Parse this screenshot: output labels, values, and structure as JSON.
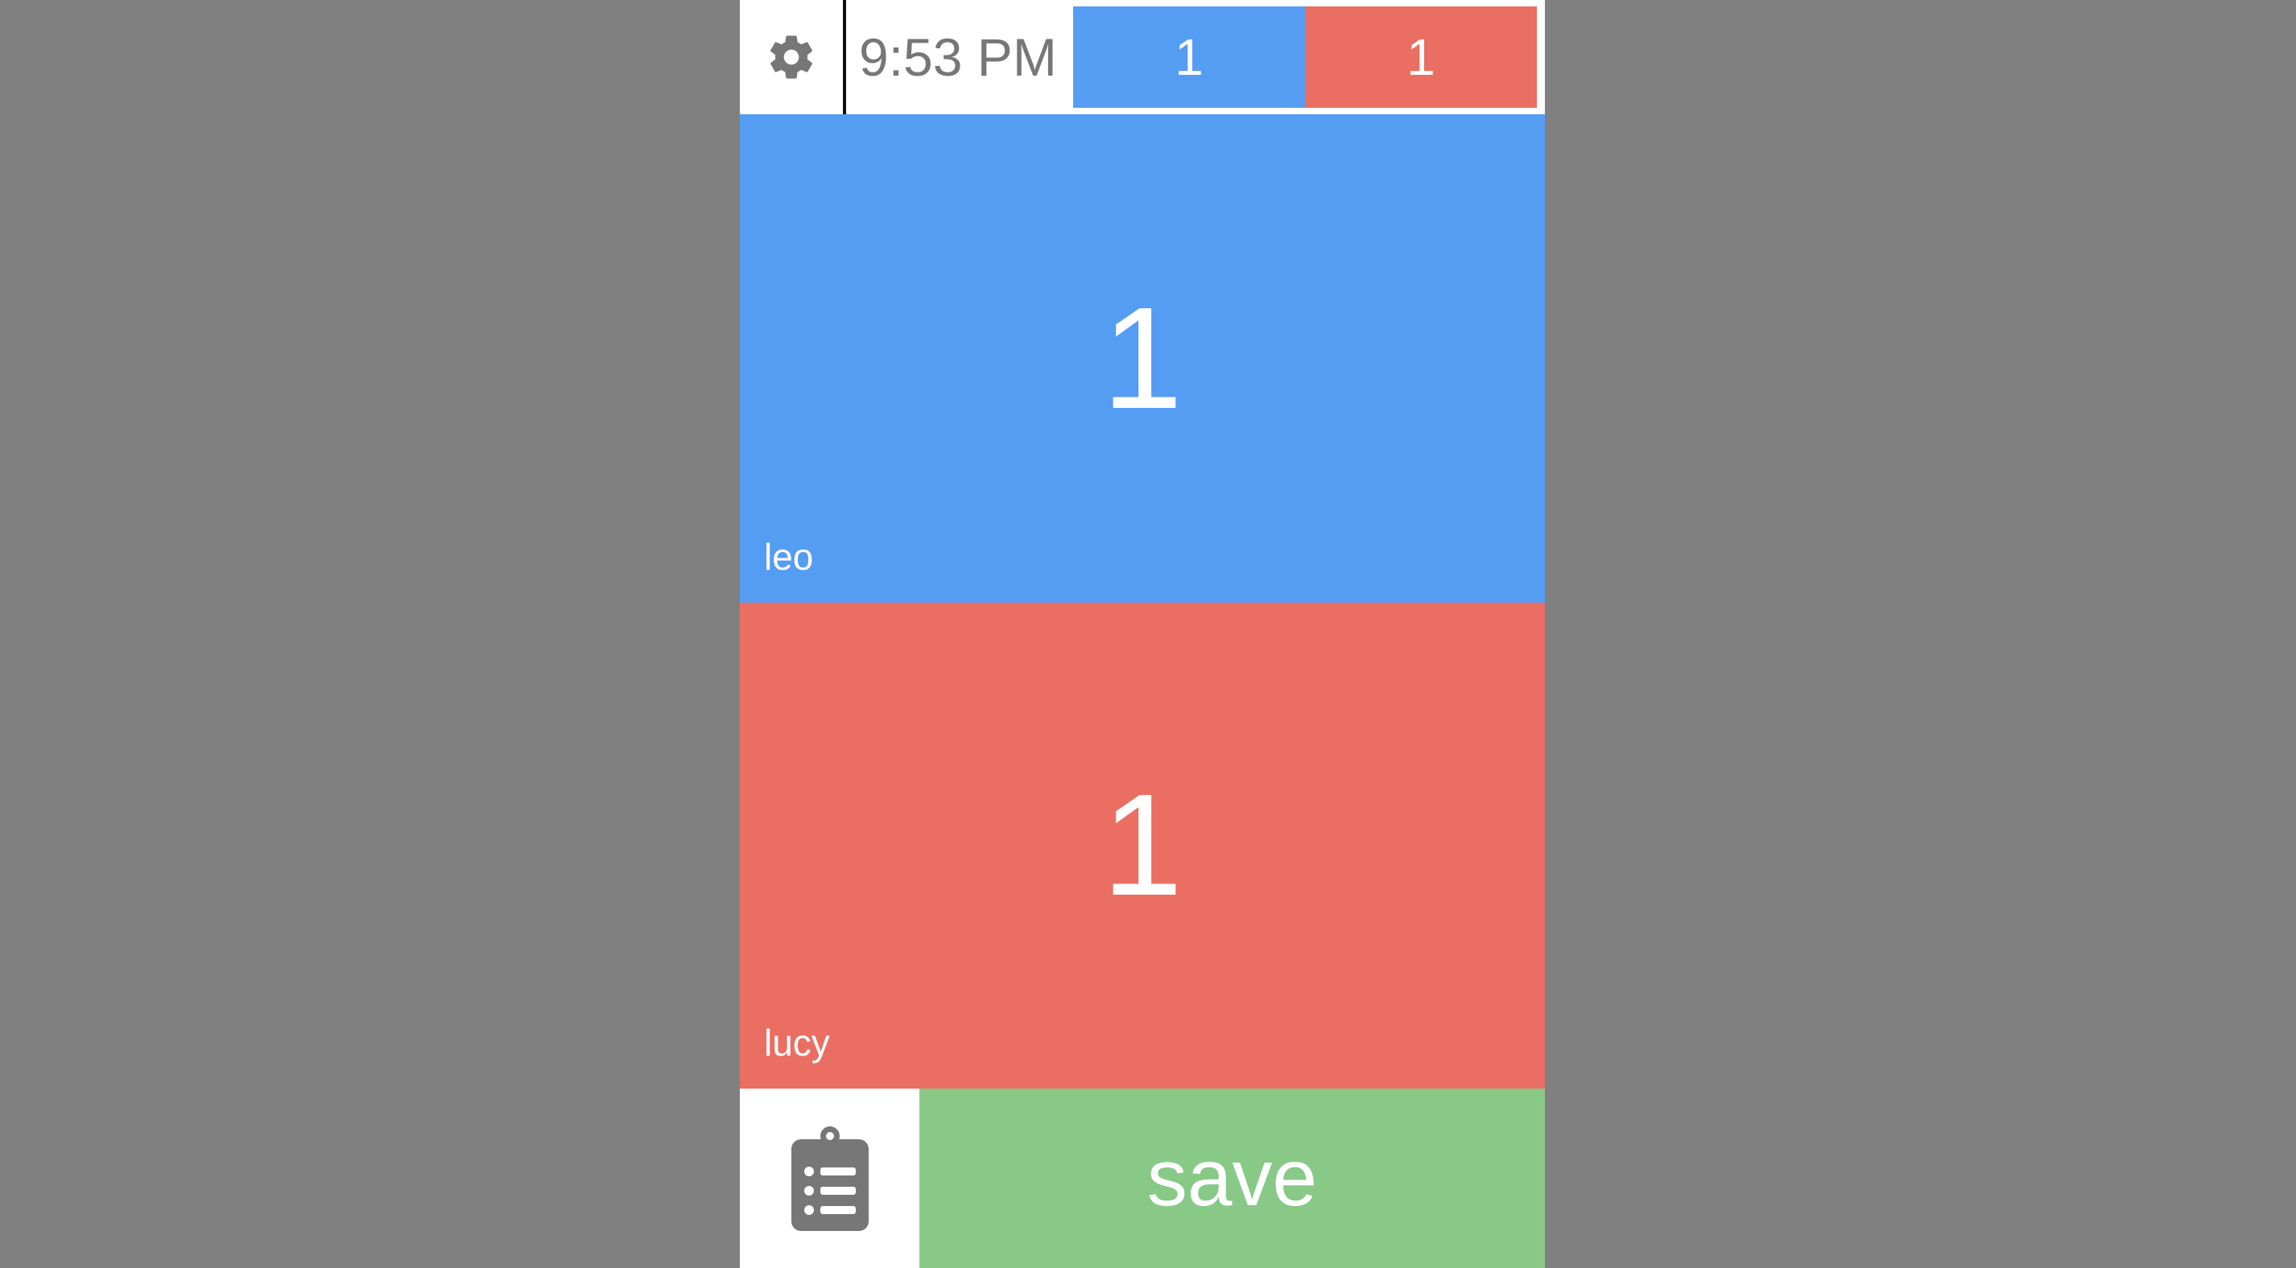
{
  "header": {
    "settings_icon": "gear-icon",
    "time": "9:53 PM"
  },
  "players": [
    {
      "name": "leo",
      "score": "1",
      "color": "#559cf3"
    },
    {
      "name": "lucy",
      "score": "1",
      "color": "#eb6e62"
    }
  ],
  "footer": {
    "history_icon": "clipboard-list-icon",
    "save_label": "save",
    "save_color": "#88c987"
  },
  "colors": {
    "background": "#808080",
    "icon": "#777777"
  }
}
